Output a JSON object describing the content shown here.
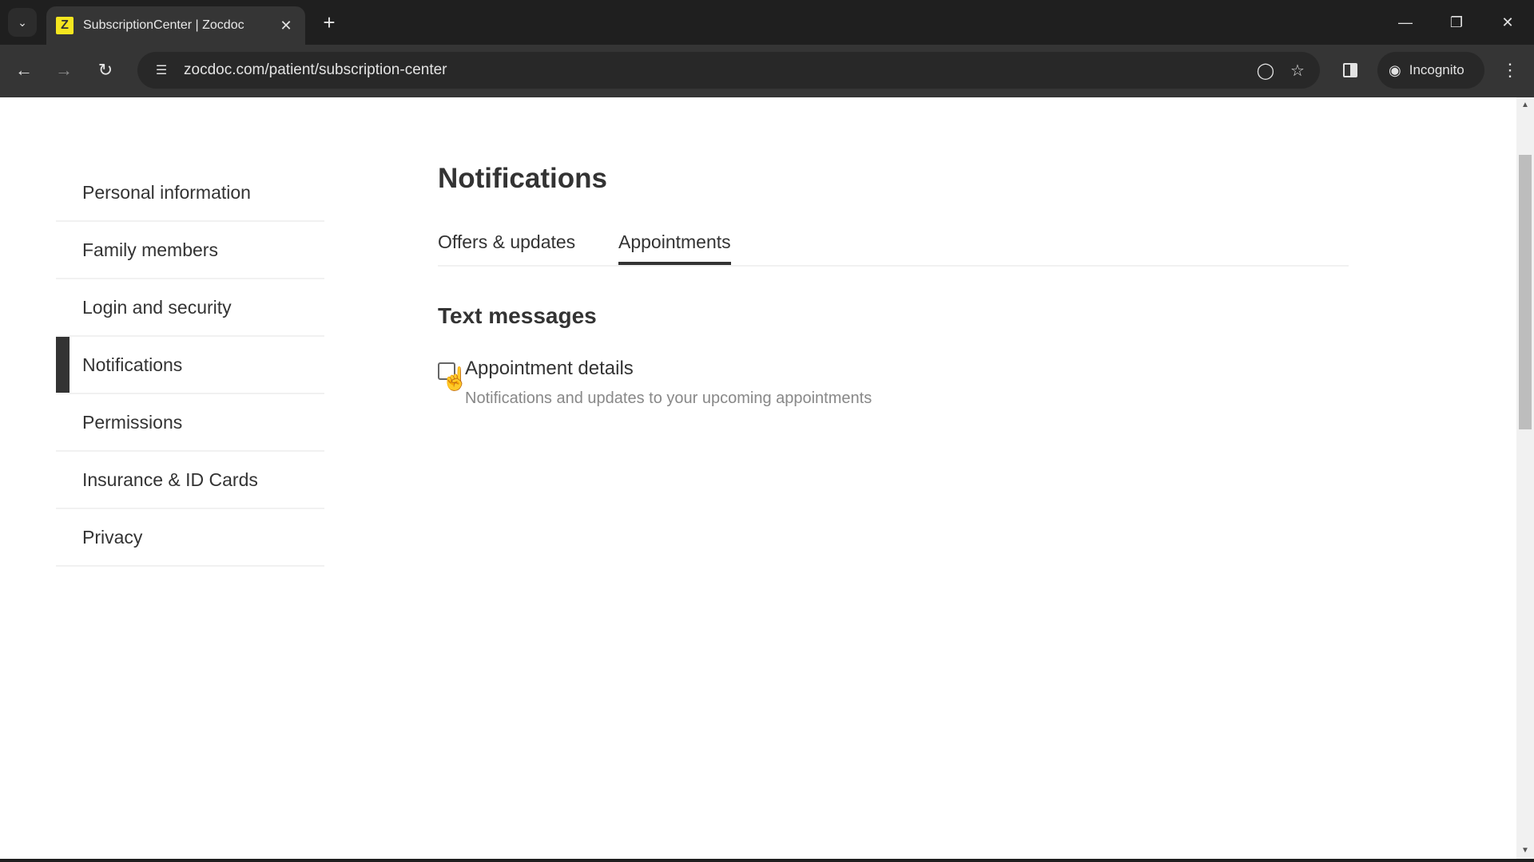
{
  "browser": {
    "tab_title": "SubscriptionCenter | Zocdoc",
    "favicon_glyph": "Z",
    "favicon_color": "#f5e61f",
    "url": "zocdoc.com/patient/subscription-center",
    "incognito_label": "Incognito",
    "icons": {
      "tab_search": "chevron-down-icon",
      "close_tab": "close-icon",
      "new_tab": "plus-icon",
      "back": "arrow-left-icon",
      "forward": "arrow-right-icon",
      "reload": "reload-icon",
      "site_info": "tune-icon",
      "tracking": "eye-off-icon",
      "bookmark": "star-icon",
      "side_panel": "side-panel-icon",
      "incognito": "incognito-icon",
      "menu": "more-vert-icon",
      "minimize": "minimize-icon",
      "restore": "restore-icon",
      "close_window": "close-icon"
    }
  },
  "sidebar": {
    "items": [
      {
        "label": "Personal information",
        "active": false
      },
      {
        "label": "Family members",
        "active": false
      },
      {
        "label": "Login and security",
        "active": false
      },
      {
        "label": "Notifications",
        "active": true
      },
      {
        "label": "Permissions",
        "active": false
      },
      {
        "label": "Insurance & ID Cards",
        "active": false
      },
      {
        "label": "Privacy",
        "active": false
      }
    ]
  },
  "main": {
    "title": "Notifications",
    "tabs": [
      {
        "label": "Offers & updates",
        "active": false
      },
      {
        "label": "Appointments",
        "active": true
      }
    ],
    "section_title": "Text messages",
    "options": [
      {
        "label": "Appointment details",
        "description": "Notifications and updates to your upcoming appointments",
        "checked": false
      }
    ]
  }
}
